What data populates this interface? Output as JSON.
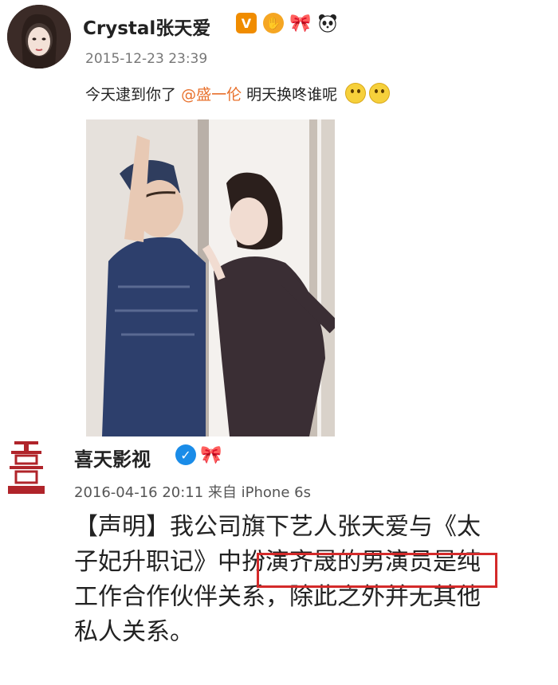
{
  "post1": {
    "username": "Crystal张天爱",
    "badges": [
      "v-badge-icon",
      "hand-badge-icon",
      "ribbon-badge-icon",
      "panda-badge-icon"
    ],
    "timestamp": "2015-12-23 23:39",
    "text_before": "今天逮到你了",
    "mention": "@盛一伦",
    "text_after": "明天换咚谁呢"
  },
  "post2": {
    "account": "喜天影视",
    "logo_glyph": "喜",
    "logo_caption": "喜天影视",
    "timestamp_line": "2016-04-16 20:11 来自 iPhone 6s",
    "lines": [
      "【声明】我公司旗下艺人张天爱与《太",
      "子妃升职记》中扮演齐晟的男演员是纯",
      "工作合作伙伴关系，除此之外并无其他",
      "私人关系。"
    ]
  },
  "colors": {
    "mention": "#e8712d",
    "verified_blue": "#1a8ce8",
    "highlight_box": "#d42a2a"
  }
}
